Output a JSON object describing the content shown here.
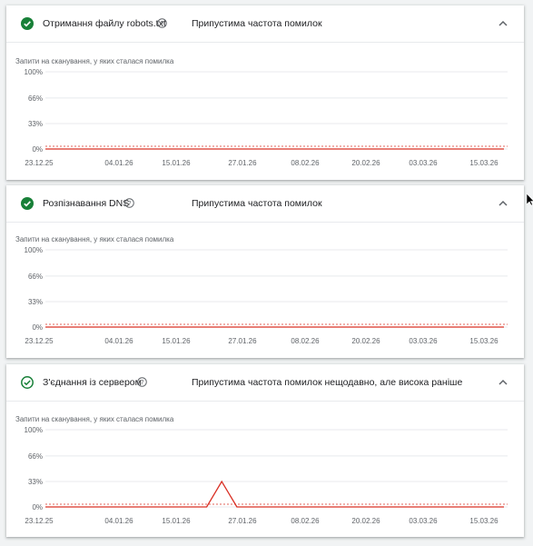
{
  "chart_ylabel": "Запити на сканування, у яких сталася помилка",
  "y_ticks": [
    "100%",
    "66%",
    "33%",
    "0%"
  ],
  "x_ticks": [
    "23.12.25",
    "04.01.26",
    "15.01.26",
    "27.01.26",
    "08.02.26",
    "20.02.26",
    "03.03.26",
    "15.03.26"
  ],
  "colors": {
    "ok_green": "#188038",
    "line_red": "#d93025",
    "threshold_red": "#d93025",
    "grid": "#e8eaed"
  },
  "cards": [
    {
      "title": "Отримання файлу robots.txt",
      "status": "Припустима частота помилок",
      "icon": "check-circle-filled-icon",
      "chart_data": {
        "type": "line",
        "ylabel": "Запити на сканування, у яких сталася помилка",
        "ylim": [
          0,
          100
        ],
        "y_unit": "%",
        "x_range": [
          "23.12.25",
          "24.03.26"
        ],
        "series": [
          {
            "values": [
              [
                0,
                0
              ],
              [
                91,
                0
              ]
            ]
          }
        ]
      }
    },
    {
      "title": "Розпізнавання DNS",
      "status": "Припустима частота помилок",
      "icon": "check-circle-filled-icon",
      "chart_data": {
        "type": "line",
        "ylabel": "Запити на сканування, у яких сталася помилка",
        "ylim": [
          0,
          100
        ],
        "y_unit": "%",
        "x_range": [
          "23.12.25",
          "24.03.26"
        ],
        "series": [
          {
            "values": [
              [
                0,
                0
              ],
              [
                91,
                0
              ]
            ]
          }
        ]
      }
    },
    {
      "title": "З'єднання із сервером",
      "status": "Припустима частота помилок нещодавно, але висока раніше",
      "icon": "check-circle-outline-icon",
      "chart_data": {
        "type": "line",
        "ylabel": "Запити на сканування, у яких сталася помилка",
        "ylim": [
          0,
          100
        ],
        "y_unit": "%",
        "x_range": [
          "23.12.25",
          "24.03.26"
        ],
        "series": [
          {
            "values": [
              [
                0,
                0
              ],
              [
                32,
                0
              ],
              [
                35,
                33
              ],
              [
                38,
                0
              ],
              [
                91,
                0
              ]
            ]
          }
        ]
      }
    }
  ]
}
